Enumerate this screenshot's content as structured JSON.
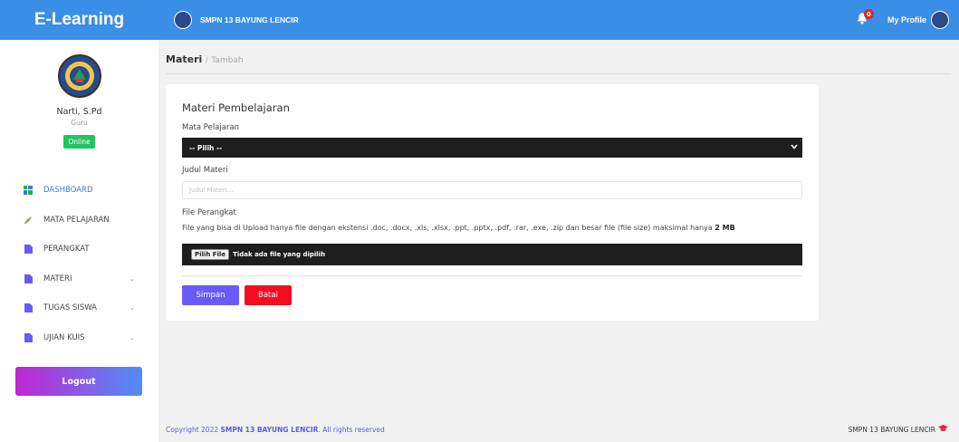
{
  "app": {
    "brand": "E-Learning"
  },
  "topbar": {
    "school_name": "SMPN 13 BAYUNG LENCIR",
    "notification_count": "0",
    "profile_label": "My Profile"
  },
  "user": {
    "name": "Narti, S.Pd",
    "role": "Guru",
    "status": "Online"
  },
  "sidebar": {
    "items": [
      {
        "label": "DASHBOARD",
        "icon": "dashboard-icon"
      },
      {
        "label": "MATA PELAJARAN",
        "icon": "leaf-icon"
      },
      {
        "label": "PERANGKAT",
        "icon": "document-icon"
      },
      {
        "label": "MATERI",
        "icon": "document-icon",
        "chevron": "⌄"
      },
      {
        "label": "TUGAS SISWA",
        "icon": "document-icon",
        "chevron": "⌄"
      },
      {
        "label": "UJIAN KUIS",
        "icon": "document-icon",
        "chevron": "⌄"
      }
    ],
    "logout_label": "Logout"
  },
  "breadcrumb": {
    "current": "Materi",
    "separator": "/",
    "sub": "Tambah"
  },
  "form": {
    "title": "Materi Pembelajaran",
    "subject_label": "Mata Pelajaran",
    "subject_selected": "-- Pilih --",
    "title_label": "Judul Materi",
    "title_placeholder": "Judul Materi...",
    "file_label": "File Perangkat",
    "file_note": "File yang bisa di Upload hanya file dengan ekstensi .doc, .docx, .xls, .xlsx, .ppt, .pptx, .pdf, .rar, .exe, .zip dan besar file (file size) maksimal hanya",
    "file_note_max": "2 MB",
    "file_button": "Pilih File",
    "file_status": "Tidak ada file yang dipilih",
    "save_label": "Simpan",
    "cancel_label": "Batal"
  },
  "footer": {
    "copyright_prefix": "Copyright 2022",
    "copyright_school": "SMPN 13 BAYUNG LENCIR",
    "copyright_suffix": ". All rights reserved",
    "right_text": "SMPN 13 BAYUNG LENCIR"
  },
  "colors": {
    "primary": "#3b8ee6",
    "save": "#6a5af9",
    "cancel": "#f50d1f",
    "online": "#22c55e"
  }
}
